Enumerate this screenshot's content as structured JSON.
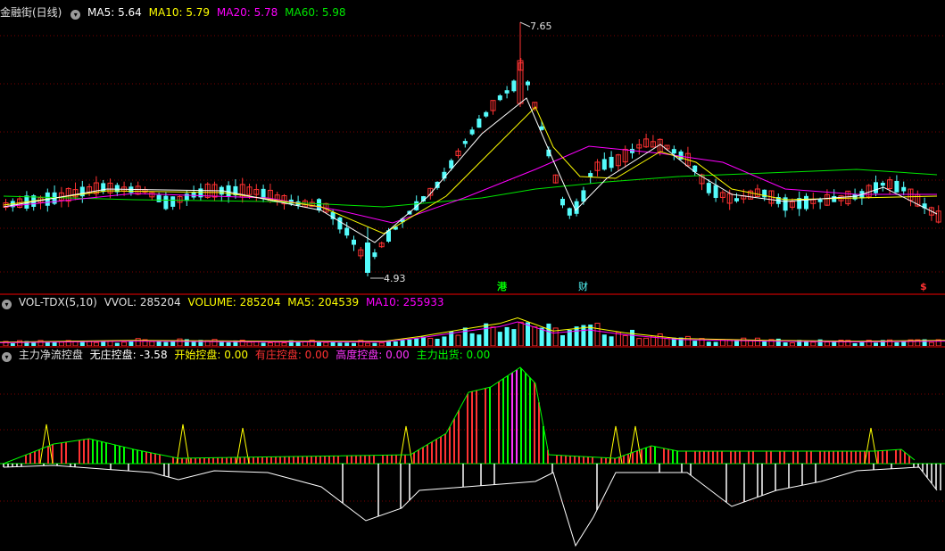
{
  "price_legend": {
    "title": "金融街(日线)",
    "ma5": "MA5: 5.64",
    "ma10": "MA10: 5.79",
    "ma20": "MA20: 5.78",
    "ma60": "MA60: 5.98"
  },
  "price_annotations": {
    "high": "7.65",
    "low": "4.93"
  },
  "markers": {
    "hk": "港",
    "fin": "财",
    "dollar": "$"
  },
  "volume_legend": {
    "title": "VOL-TDX(5,10)",
    "vvol": "VVOL: 285204",
    "volume": "VOLUME: 285204",
    "ma5": "MA5: 204539",
    "ma10": "MA10: 255933"
  },
  "indicator_legend": {
    "title": "主力净流控盘",
    "no_control": "无庄控盘: -3.58",
    "start_control": "开始控盘: 0.00",
    "has_control": "有庄控盘: 0.00",
    "high_control": "高度控盘: 0.00",
    "distribution": "主力出货: 0.00"
  },
  "colors": {
    "up": "#ff3232",
    "down": "#54fcfc",
    "ma5": "#ffffff",
    "ma10": "#ffff00",
    "ma20": "#ff00ff",
    "ma60": "#00e600",
    "grid": "#7a0000",
    "green": "#00ff00",
    "white": "#ffffff",
    "magenta": "#ff33ff",
    "yellow": "#ffff00"
  },
  "chart_data": [
    {
      "type": "candlestick",
      "title": "金融街(日线)",
      "y_range": [
        4.93,
        7.65
      ],
      "annotated_high": 7.65,
      "annotated_low": 4.93,
      "moving_averages": {
        "MA5": 5.64,
        "MA10": 5.79,
        "MA20": 5.78,
        "MA60": 5.98
      }
    },
    {
      "type": "bar",
      "title": "VOL-TDX(5,10)",
      "latest": {
        "VVOL": 285204,
        "VOLUME": 285204,
        "MA5": 204539,
        "MA10": 255933
      }
    },
    {
      "type": "bar",
      "title": "主力净流控盘",
      "latest": {
        "无庄控盘": -3.58,
        "开始控盘": 0.0,
        "有庄控盘": 0.0,
        "高度控盘": 0.0,
        "主力出货": 0.0
      }
    }
  ]
}
